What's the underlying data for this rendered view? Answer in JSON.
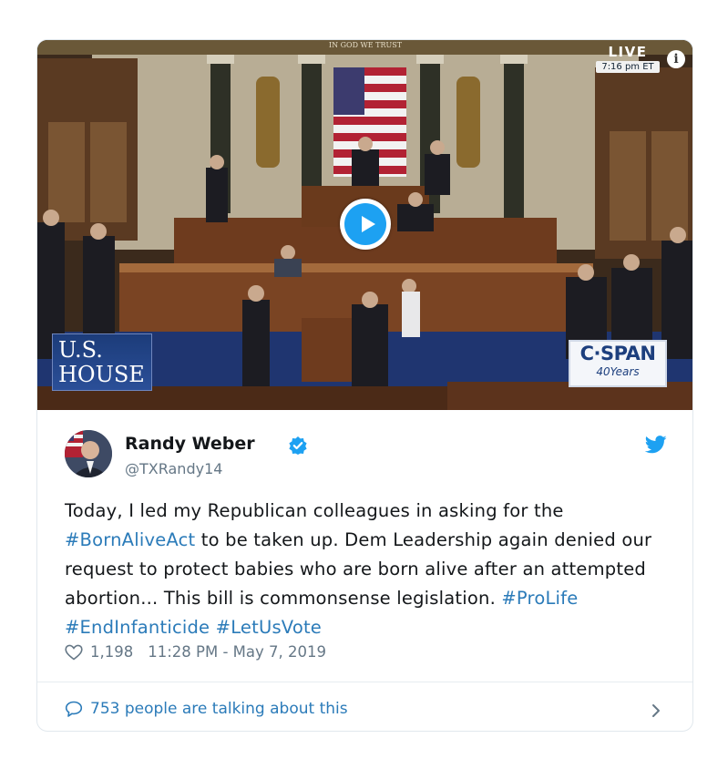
{
  "media": {
    "live_label": "LIVE",
    "live_time": "7:16 pm ET",
    "info_glyph": "i",
    "motto": "IN GOD WE TRUST",
    "house_logo_line1": "U.S.",
    "house_logo_line2": "HOUSE",
    "cspan_name": "C·SPAN",
    "cspan_years": "40Years",
    "play_icon": "play-icon"
  },
  "tweet": {
    "name": "Randy Weber",
    "handle": "@TXRandy14",
    "text_parts": {
      "p1": "Today, I led my Republican colleagues in asking for the ",
      "h1": "#BornAliveAct",
      "p2": " to be taken up. Dem Leadership again denied our request to protect babies who are born alive after an attempted abortion... This bill is commonsense legislation. ",
      "h2": "#ProLife",
      "h3": "#EndInfanticide",
      "h4": "#LetUsVote"
    },
    "likes": "1,198",
    "timestamp": "11:28 PM - May 7, 2019",
    "talking": "753 people are talking about this"
  },
  "colors": {
    "accent": "#1da1f2",
    "hashtag": "#2b7bb9",
    "secondary_text": "#657786"
  },
  "icons": [
    "play-icon",
    "info-icon",
    "verified-badge-icon",
    "twitter-bird-icon",
    "heart-icon",
    "comment-bubble-icon",
    "chevron-right-icon"
  ]
}
